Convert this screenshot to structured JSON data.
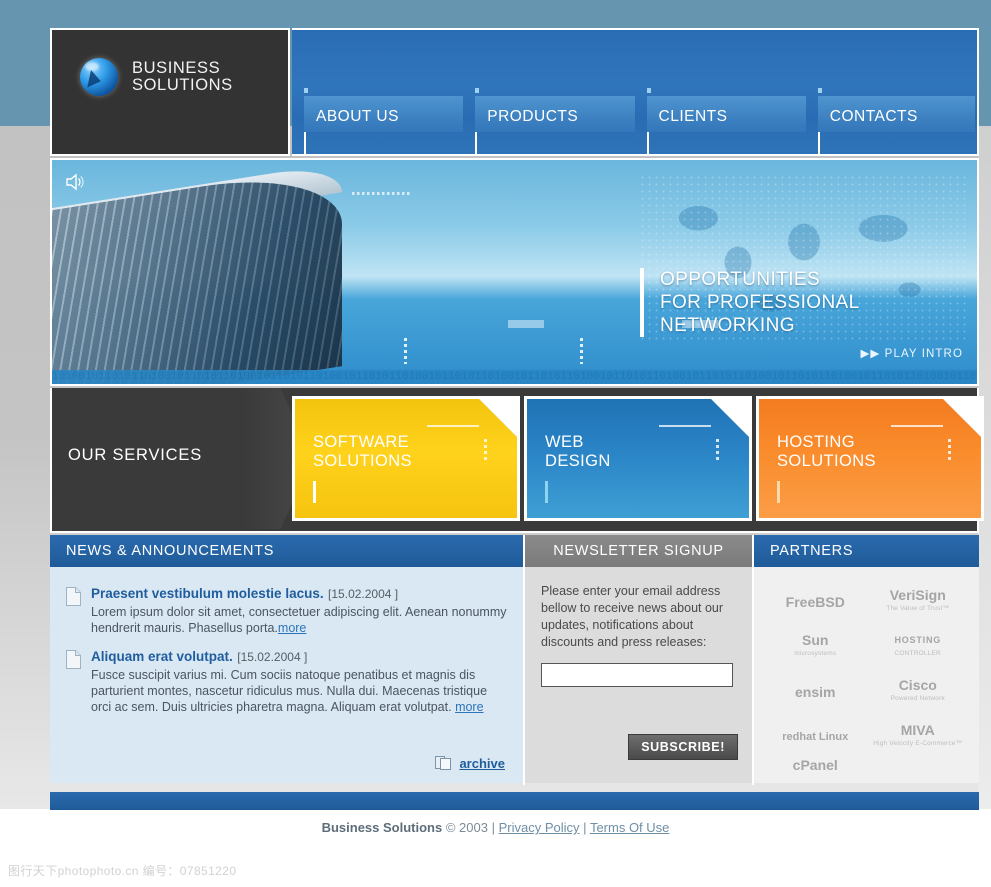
{
  "site": {
    "logo": {
      "icon": "globe-icon",
      "line1": "BUSINESS",
      "line2": "SOLUTIONS"
    },
    "nav": [
      {
        "label": "ABOUT US"
      },
      {
        "label": "PRODUCTS"
      },
      {
        "label": "CLIENTS"
      },
      {
        "label": "CONTACTS"
      }
    ]
  },
  "banner": {
    "sound_icon": "speaker-icon",
    "caption_line1": "OPPORTUNITIES",
    "caption_line2": "FOR PROFESSIONAL NETWORKING",
    "play_intro": "PLAY INTRO",
    "play_icon": "fast-forward-icon",
    "binary_strip": "1010010110101101001011010110100101101011010010110101101001011010110100101101011010010110101101001011010110100101101011010010110101101001011010"
  },
  "services": {
    "heading": "OUR SERVICES",
    "items": [
      {
        "line1": "SOFTWARE",
        "line2": "SOLUTIONS",
        "color": "#f5c40f"
      },
      {
        "line1": "WEB",
        "line2": "DESIGN",
        "color": "#2a84c6"
      },
      {
        "line1": "HOSTING",
        "line2": "SOLUTIONS",
        "color": "#fa8c2c"
      }
    ]
  },
  "news": {
    "heading": "NEWS & ANNOUNCEMENTS",
    "items": [
      {
        "icon": "document-icon",
        "title": "Praesent vestibulum molestie lacus.",
        "date": "[15.02.2004 ]",
        "body": "Lorem ipsum dolor sit amet, consectetuer adipiscing elit. Aenean nonummy hendrerit mauris. Phasellus porta.",
        "more": "more"
      },
      {
        "icon": "document-icon",
        "title": "Aliquam erat volutpat.",
        "date": "[15.02.2004 ]",
        "body": "Fusce suscipit varius mi. Cum sociis natoque penatibus et magnis dis parturient montes, nascetur ridiculus mus. Nulla dui. Maecenas tristique orci ac sem. Duis ultricies pharetra magna. Aliquam erat volutpat.",
        "more": "more"
      }
    ],
    "archive_label": "archive",
    "archive_icon": "copy-pages-icon"
  },
  "newsletter": {
    "heading": "NEWSLETTER SIGNUP",
    "description": "Please enter your email address bellow to receive news about our updates, notifications about discounts and press releases:",
    "email_value": "",
    "email_placeholder": "",
    "subscribe_label": "SUBSCRIBE!"
  },
  "partners": {
    "heading": "PARTNERS",
    "logos": [
      {
        "name": "FreeBSD",
        "sub": ""
      },
      {
        "name": "VeriSign",
        "sub": "The Value of Trust™"
      },
      {
        "name": "Sun",
        "sub": "microsystems"
      },
      {
        "name": "HOSTING",
        "sub": "CONTROLLER"
      },
      {
        "name": "ensim",
        "sub": ""
      },
      {
        "name": "Cisco",
        "sub": "Powered Network"
      },
      {
        "name": "redhat Linux",
        "sub": ""
      },
      {
        "name": "MIVA",
        "sub": "High Velocity E-Commerce™"
      },
      {
        "name": "cPanel",
        "sub": ""
      }
    ]
  },
  "footer": {
    "brand": "Business Solutions",
    "copyright": "© 2003",
    "sep1": "|",
    "privacy": "Privacy Policy",
    "sep2": "|",
    "terms": "Terms Of Use"
  },
  "watermark": {
    "text": "图行天下photophoto.cn  编号：07851220"
  },
  "colors": {
    "nav_blue": "#2e73b8",
    "header_dark": "#333333",
    "services_dark": "#3a3a3a",
    "yellow": "#f5c40f",
    "blue": "#2a84c6",
    "orange": "#fa8c2c",
    "heading_blue": "#1f5b99",
    "page_top": "#6695b0"
  }
}
